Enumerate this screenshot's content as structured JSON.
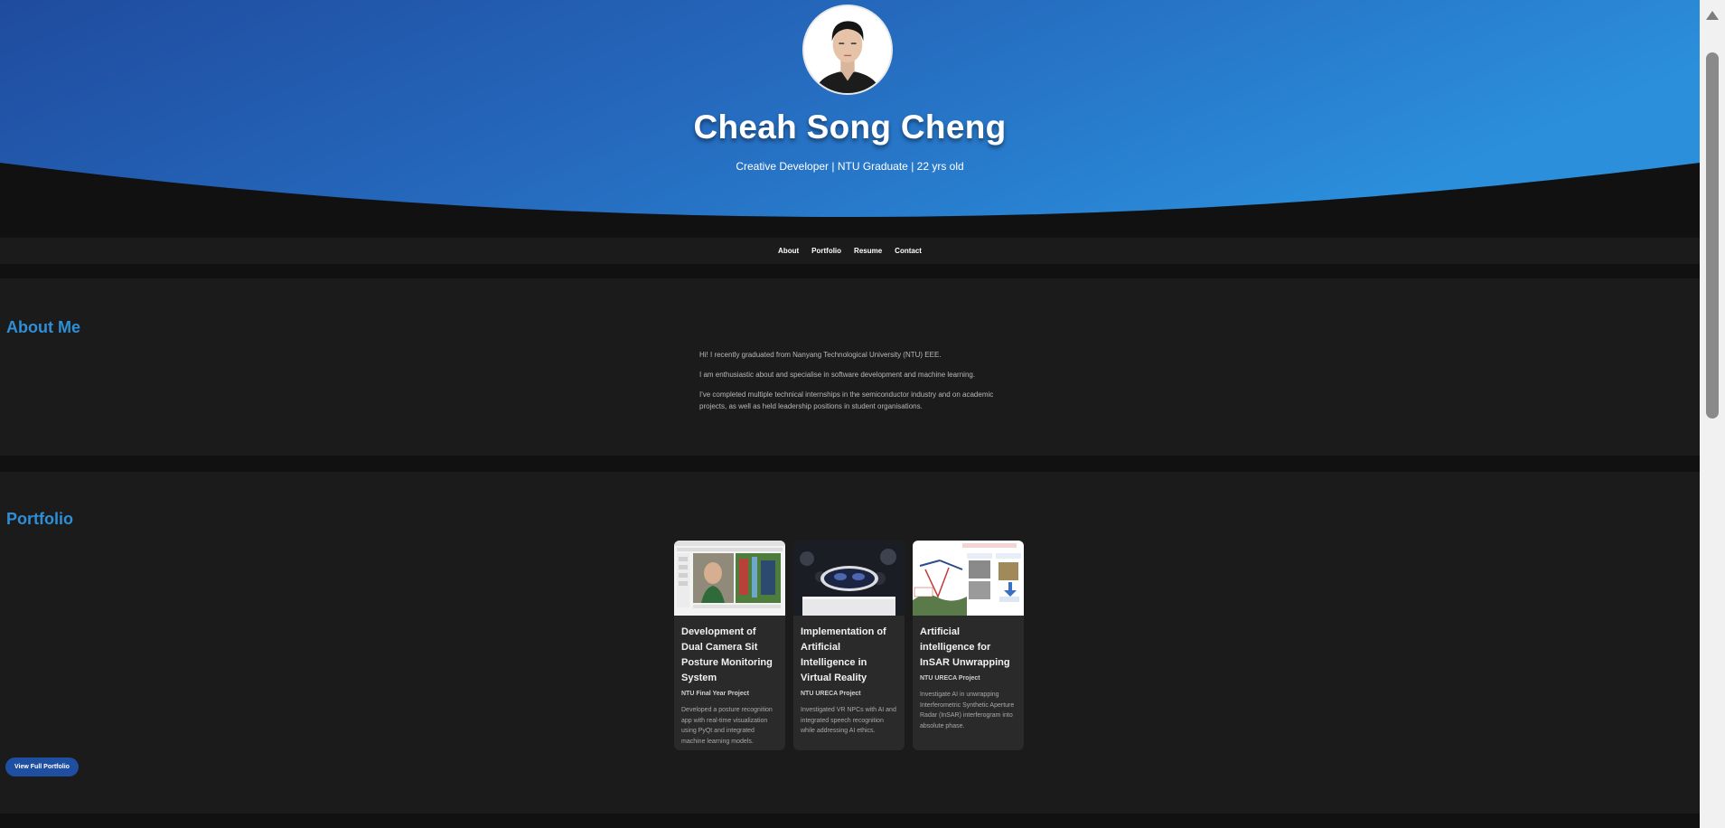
{
  "hero": {
    "name": "Cheah Song Cheng",
    "subtitle": "Creative Developer | NTU Graduate | 22 yrs old",
    "avatar_alt": "Profile photo"
  },
  "nav": {
    "items": [
      "About",
      "Portfolio",
      "Resume",
      "Contact"
    ]
  },
  "about": {
    "title": "About Me",
    "paragraphs": [
      "Hi! I recently graduated from Nanyang Technological University (NTU) EEE.",
      "I am enthusiastic about and specialise in software development and machine learning.",
      "I've completed multiple technical internships in the semiconductor industry and on academic projects, as well as held leadership positions in student organisations."
    ]
  },
  "portfolio": {
    "title": "Portfolio",
    "cards": [
      {
        "title": "Development of Dual Camera Sit Posture Monitoring System",
        "subtitle": "NTU Final Year Project",
        "description": "Developed a posture recognition app with real-time visualization using PyQt and integrated machine learning models."
      },
      {
        "title": "Implementation of Artificial Intelligence in Virtual Reality",
        "subtitle": "NTU URECA Project",
        "description": "Investigated VR NPCs with AI and integrated speech recognition while addressing AI ethics."
      },
      {
        "title": "Artificial intelligence for InSAR Unwrapping",
        "subtitle": "NTU URECA Project",
        "description": "Investigate AI in unwrapping Interferometric Synthetic Aperture Radar (InSAR) interferogram into absolute phase."
      }
    ],
    "button_label": "View Full Portfolio"
  },
  "colors": {
    "hero_gradient_start": "#1f4fa3",
    "hero_gradient_end": "#2a8ad8",
    "accent": "#2e8fd6",
    "background": "#111111",
    "section": "#1b1b1b",
    "card": "#2a2a2a",
    "button": "#1e4fa0"
  },
  "icons": {
    "scroll_up": "triangle-up"
  }
}
